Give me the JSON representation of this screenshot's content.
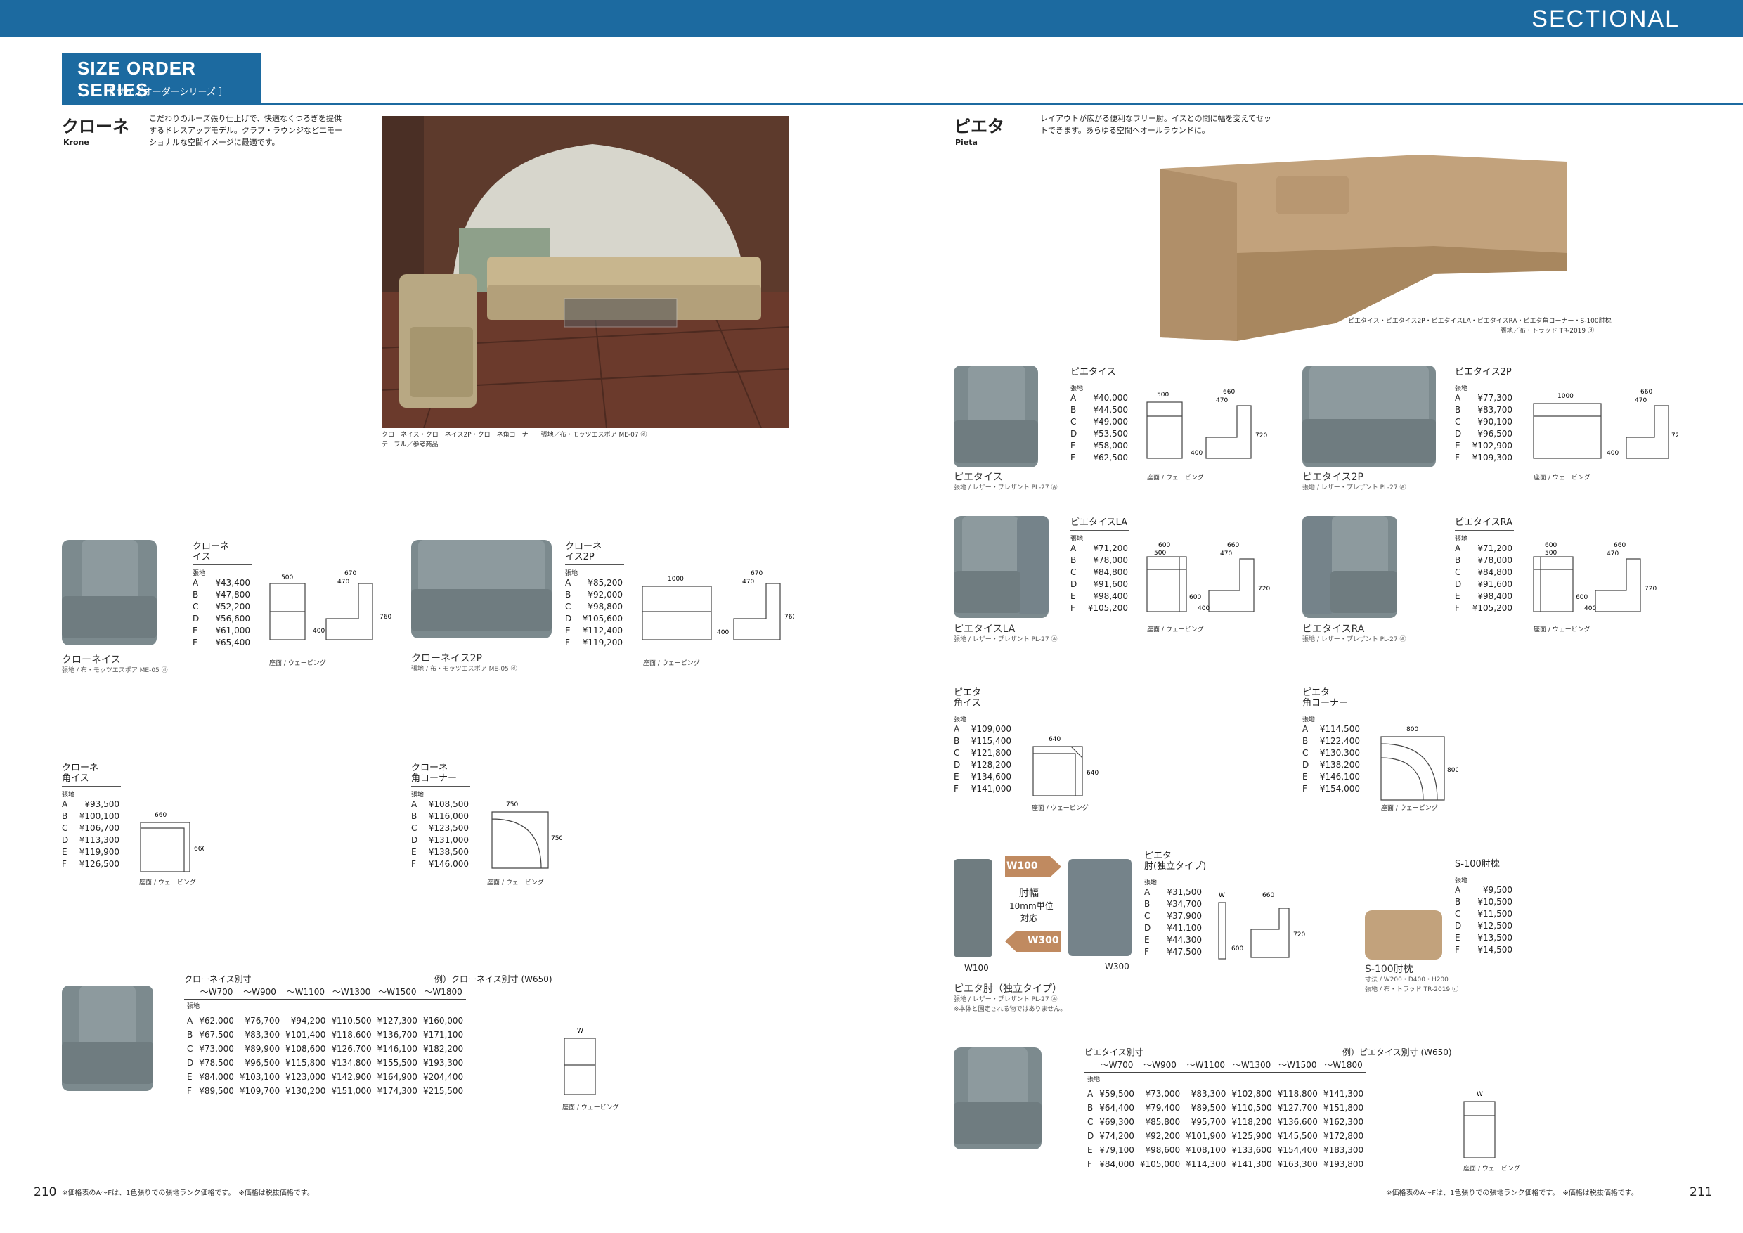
{
  "header": {
    "section": "SECTIONAL",
    "series_title": "SIZE ORDER SERIES",
    "series_sub": "［ サイズオーダーシリーズ ］"
  },
  "krone": {
    "name_jp": "クローネ",
    "name_en": "Krone",
    "desc": "こだわりのルーズ張り仕上げで、快適なくつろぎを提供するドレスアップモデル。クラブ・ラウンジなどエモーショナルな空間イメージに最適です。",
    "caption": "クローネイス・クローネイス2P・クローネ角コーナー　張地／布・モッツエスポア ME-07 ⓓ\nテーブル／参考商品"
  },
  "pieta": {
    "name_jp": "ピエタ",
    "name_en": "Pieta",
    "desc": "レイアウトが広がる便利なフリー肘。イスとの間に幅を変えてセットできます。あらゆる空間へオールラウンドに。",
    "caption": "ピエタイス・ピエタイス2P・ピエタイスLA・ピエタイスRA・ピエタ角コーナー・S-100肘枕\n張地／布・トラッド TR-2019 ⓓ"
  },
  "grade_label": "張地",
  "drawing_label": "座面 / ウェービング",
  "products": [
    {
      "id": "krone-isu",
      "name": "クローネ\nイス",
      "label": "クローネイス",
      "material": "張地 / 布・モッツエスポア ME-05 ⓓ",
      "prices": [
        [
          "A",
          "¥43,400"
        ],
        [
          "B",
          "¥47,800"
        ],
        [
          "C",
          "¥52,200"
        ],
        [
          "D",
          "¥56,600"
        ],
        [
          "E",
          "¥61,000"
        ],
        [
          "F",
          "¥65,400"
        ]
      ],
      "dims": [
        "500",
        "670",
        "470",
        "400",
        "760"
      ]
    },
    {
      "id": "krone-isu2p",
      "name": "クローネ\nイス2P",
      "label": "クローネイス2P",
      "material": "張地 / 布・モッツエスポア ME-05 ⓓ",
      "prices": [
        [
          "A",
          "¥85,200"
        ],
        [
          "B",
          "¥92,000"
        ],
        [
          "C",
          "¥98,800"
        ],
        [
          "D",
          "¥105,600"
        ],
        [
          "E",
          "¥112,400"
        ],
        [
          "F",
          "¥119,200"
        ]
      ],
      "dims": [
        "1000",
        "670",
        "470",
        "400",
        "760"
      ]
    },
    {
      "id": "krone-kakuisu",
      "name": "クローネ\n角イス",
      "prices": [
        [
          "A",
          "¥93,500"
        ],
        [
          "B",
          "¥100,100"
        ],
        [
          "C",
          "¥106,700"
        ],
        [
          "D",
          "¥113,300"
        ],
        [
          "E",
          "¥119,900"
        ],
        [
          "F",
          "¥126,500"
        ]
      ],
      "dims": [
        "660",
        "660"
      ]
    },
    {
      "id": "krone-kakucorner",
      "name": "クローネ\n角コーナー",
      "prices": [
        [
          "A",
          "¥108,500"
        ],
        [
          "B",
          "¥116,000"
        ],
        [
          "C",
          "¥123,500"
        ],
        [
          "D",
          "¥131,000"
        ],
        [
          "E",
          "¥138,500"
        ],
        [
          "F",
          "¥146,000"
        ]
      ],
      "dims": [
        "750",
        "750"
      ]
    },
    {
      "id": "pieta-isu",
      "name": "ピエタイス",
      "label": "ピエタイス",
      "material": "張地 / レザー・プレザント PL-27 Ⓐ",
      "prices": [
        [
          "A",
          "¥40,000"
        ],
        [
          "B",
          "¥44,500"
        ],
        [
          "C",
          "¥49,000"
        ],
        [
          "D",
          "¥53,500"
        ],
        [
          "E",
          "¥58,000"
        ],
        [
          "F",
          "¥62,500"
        ]
      ],
      "dims": [
        "500",
        "660",
        "470",
        "400",
        "720"
      ]
    },
    {
      "id": "pieta-isu2p",
      "name": "ピエタイス2P",
      "label": "ピエタイス2P",
      "material": "張地 / レザー・プレザント PL-27 Ⓐ",
      "prices": [
        [
          "A",
          "¥77,300"
        ],
        [
          "B",
          "¥83,700"
        ],
        [
          "C",
          "¥90,100"
        ],
        [
          "D",
          "¥96,500"
        ],
        [
          "E",
          "¥102,900"
        ],
        [
          "F",
          "¥109,300"
        ]
      ],
      "dims": [
        "1000",
        "660",
        "470",
        "400",
        "720"
      ]
    },
    {
      "id": "pieta-isula",
      "name": "ピエタイスLA",
      "label": "ピエタイスLA",
      "material": "張地 / レザー・プレザント PL-27 Ⓐ",
      "prices": [
        [
          "A",
          "¥71,200"
        ],
        [
          "B",
          "¥78,000"
        ],
        [
          "C",
          "¥84,800"
        ],
        [
          "D",
          "¥91,600"
        ],
        [
          "E",
          "¥98,400"
        ],
        [
          "F",
          "¥105,200"
        ]
      ],
      "dims": [
        "600",
        "500",
        "660",
        "470",
        "600",
        "400",
        "720"
      ]
    },
    {
      "id": "pieta-isura",
      "name": "ピエタイスRA",
      "label": "ピエタイスRA",
      "material": "張地 / レザー・プレザント PL-27 Ⓐ",
      "prices": [
        [
          "A",
          "¥71,200"
        ],
        [
          "B",
          "¥78,000"
        ],
        [
          "C",
          "¥84,800"
        ],
        [
          "D",
          "¥91,600"
        ],
        [
          "E",
          "¥98,400"
        ],
        [
          "F",
          "¥105,200"
        ]
      ],
      "dims": [
        "600",
        "500",
        "660",
        "470",
        "600",
        "400",
        "720"
      ]
    },
    {
      "id": "pieta-kakuisu",
      "name": "ピエタ\n角イス",
      "prices": [
        [
          "A",
          "¥109,000"
        ],
        [
          "B",
          "¥115,400"
        ],
        [
          "C",
          "¥121,800"
        ],
        [
          "D",
          "¥128,200"
        ],
        [
          "E",
          "¥134,600"
        ],
        [
          "F",
          "¥141,000"
        ]
      ],
      "dims": [
        "640",
        "640"
      ]
    },
    {
      "id": "pieta-kakucorner",
      "name": "ピエタ\n角コーナー",
      "prices": [
        [
          "A",
          "¥114,500"
        ],
        [
          "B",
          "¥122,400"
        ],
        [
          "C",
          "¥130,300"
        ],
        [
          "D",
          "¥138,200"
        ],
        [
          "E",
          "¥146,100"
        ],
        [
          "F",
          "¥154,000"
        ]
      ],
      "dims": [
        "800",
        "800"
      ]
    },
    {
      "id": "pieta-hiji",
      "name": "ピエタ\n肘(独立タイプ)",
      "label": "ピエタ肘（独立タイプ）",
      "material": "張地 / レザー・プレザント PL-27 Ⓐ",
      "note": "※本体と固定される物ではありません。",
      "prices": [
        [
          "A",
          "¥31,500"
        ],
        [
          "B",
          "¥34,700"
        ],
        [
          "C",
          "¥37,900"
        ],
        [
          "D",
          "¥41,100"
        ],
        [
          "E",
          "¥44,300"
        ],
        [
          "F",
          "¥47,500"
        ]
      ],
      "dims": [
        "W",
        "660",
        "600",
        "720"
      ]
    },
    {
      "id": "s100",
      "name": "S-100肘枕",
      "label": "S-100肘枕",
      "spec": "寸法 / W200・D400・H200",
      "material": "張地 / 布・トラッド TR-2019 ⓓ",
      "prices": [
        [
          "A",
          "¥9,500"
        ],
        [
          "B",
          "¥10,500"
        ],
        [
          "C",
          "¥11,500"
        ],
        [
          "D",
          "¥12,500"
        ],
        [
          "E",
          "¥13,500"
        ],
        [
          "F",
          "¥14,500"
        ]
      ]
    }
  ],
  "armrest": {
    "w100": "W100",
    "w300": "W300",
    "text1": "肘幅",
    "text2": "10mm単位",
    "text3": "対応",
    "label_left": "W100",
    "label_right": "W300"
  },
  "krone_custom": {
    "title": "クローネイス別寸",
    "example": "例）クローネイス別寸 (W650)",
    "cols": [
      "〜W700",
      "〜W900",
      "〜W1100",
      "〜W1300",
      "〜W1500",
      "〜W1800"
    ],
    "rows": [
      [
        "A",
        "¥62,000",
        "¥76,700",
        "¥94,200",
        "¥110,500",
        "¥127,300",
        "¥160,000"
      ],
      [
        "B",
        "¥67,500",
        "¥83,300",
        "¥101,400",
        "¥118,600",
        "¥136,700",
        "¥171,100"
      ],
      [
        "C",
        "¥73,000",
        "¥89,900",
        "¥108,600",
        "¥126,700",
        "¥146,100",
        "¥182,200"
      ],
      [
        "D",
        "¥78,500",
        "¥96,500",
        "¥115,800",
        "¥134,800",
        "¥155,500",
        "¥193,300"
      ],
      [
        "E",
        "¥84,000",
        "¥103,100",
        "¥123,000",
        "¥142,900",
        "¥164,900",
        "¥204,400"
      ],
      [
        "F",
        "¥89,500",
        "¥109,700",
        "¥130,200",
        "¥151,000",
        "¥174,300",
        "¥215,500"
      ]
    ]
  },
  "pieta_custom": {
    "title": "ピエタイス別寸",
    "example": "例）ピエタイス別寸 (W650)",
    "cols": [
      "〜W700",
      "〜W900",
      "〜W1100",
      "〜W1300",
      "〜W1500",
      "〜W1800"
    ],
    "rows": [
      [
        "A",
        "¥59,500",
        "¥73,000",
        "¥83,300",
        "¥102,800",
        "¥118,800",
        "¥141,300"
      ],
      [
        "B",
        "¥64,400",
        "¥79,400",
        "¥89,500",
        "¥110,500",
        "¥127,700",
        "¥151,800"
      ],
      [
        "C",
        "¥69,300",
        "¥85,800",
        "¥95,700",
        "¥118,200",
        "¥136,600",
        "¥162,300"
      ],
      [
        "D",
        "¥74,200",
        "¥92,200",
        "¥101,900",
        "¥125,900",
        "¥145,500",
        "¥172,800"
      ],
      [
        "E",
        "¥79,100",
        "¥98,600",
        "¥108,100",
        "¥133,600",
        "¥154,400",
        "¥183,300"
      ],
      [
        "F",
        "¥84,000",
        "¥105,000",
        "¥114,300",
        "¥141,300",
        "¥163,300",
        "¥193,800"
      ]
    ]
  },
  "footer": {
    "left_page": "210",
    "right_page": "211",
    "note": "※価格表のA〜Fは、1色張りでの張地ランク価格です。　※価格は税抜価格です。",
    "w_label": "W"
  },
  "colors": {
    "brand": "#1c6aa0",
    "chair_grey": "#7c8a8e",
    "sofa_beige": "#c2a27c"
  }
}
